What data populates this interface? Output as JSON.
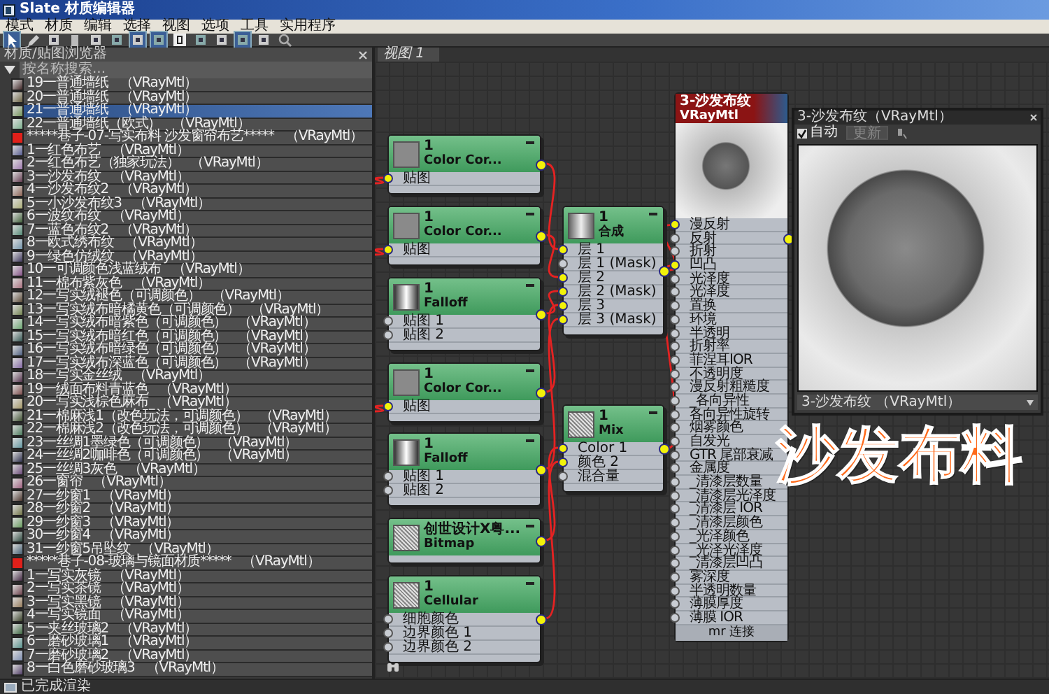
{
  "window": {
    "title": "Slate 材质编辑器"
  },
  "menu": [
    "模式",
    "材质",
    "编辑",
    "选择",
    "视图",
    "选项",
    "工具",
    "实用程序"
  ],
  "browser": {
    "title": "材质/贴图浏览器",
    "search": {
      "placeholder": "按名称搜索..."
    },
    "items": [
      {
        "kind": "material",
        "label": "19一普通墙纸",
        "type": "（VRayMtl）",
        "selected": false
      },
      {
        "kind": "material",
        "label": "20一普通墙纸",
        "type": "（VRayMtl）",
        "selected": false
      },
      {
        "kind": "material",
        "label": "21一普通墙纸",
        "type": "（VRayMtl）",
        "selected": true
      },
      {
        "kind": "material",
        "label": "22一普通墙纸（欧式）",
        "type": "（VRayMtl）",
        "selected": false
      },
      {
        "kind": "header",
        "label": "*****巷子-07-写实布料 沙发窗帘布艺*****",
        "type": "（VRayMtl）",
        "selected": false
      },
      {
        "kind": "material",
        "label": "1一红色布艺",
        "type": "（VRayMtl）",
        "selected": false
      },
      {
        "kind": "material",
        "label": "2一红色布艺（独家玩法）",
        "type": "（VRayMtl）",
        "selected": false
      },
      {
        "kind": "material",
        "label": "3一沙发布纹",
        "type": "（VRayMtl）",
        "selected": false
      },
      {
        "kind": "material",
        "label": "4一沙发布纹2",
        "type": "（VRayMtl）",
        "selected": false
      },
      {
        "kind": "material",
        "label": "5一小沙发布纹3",
        "type": "（VRayMtl）",
        "selected": false
      },
      {
        "kind": "material",
        "label": "6一波纹布纹",
        "type": "（VRayMtl）",
        "selected": false
      },
      {
        "kind": "material",
        "label": "7一蓝色布纹2",
        "type": "（VRayMtl）",
        "selected": false
      },
      {
        "kind": "material",
        "label": "8一欧式绣布纹",
        "type": "（VRayMtl）",
        "selected": false
      },
      {
        "kind": "material",
        "label": "9一绿色仿绒纹",
        "type": "（VRayMtl）",
        "selected": false
      },
      {
        "kind": "material",
        "label": "10一可调颜色浅蓝绒布",
        "type": "（VRayMtl）",
        "selected": false
      },
      {
        "kind": "material",
        "label": "11一棉布紫灰色",
        "type": "（VRayMtl）",
        "selected": false
      },
      {
        "kind": "material",
        "label": "12一写实绒褪色（可调颜色）",
        "type": "（VRayMtl）",
        "selected": false
      },
      {
        "kind": "material",
        "label": "13一写实绒布暗橘黄色（可调颜色）",
        "type": "（VRayMtl）",
        "selected": false
      },
      {
        "kind": "material",
        "label": "14一写实绒布暗紫色（可调颜色）",
        "type": "（VRayMtl）",
        "selected": false
      },
      {
        "kind": "material",
        "label": "15一写实绒布暗红色（可调颜色）",
        "type": "（VRayMtl）",
        "selected": false
      },
      {
        "kind": "material",
        "label": "16一写实绒布暗绿色（可调颜色）",
        "type": "（VRayMtl）",
        "selected": false
      },
      {
        "kind": "material",
        "label": "17一写实绒布深蓝色（可调颜色）",
        "type": "（VRayMtl）",
        "selected": false
      },
      {
        "kind": "material",
        "label": "18一写实金丝绒",
        "type": "（VRayMtl）",
        "selected": false
      },
      {
        "kind": "material",
        "label": "19一绒面布料青蓝色",
        "type": "（VRayMtl）",
        "selected": false
      },
      {
        "kind": "material",
        "label": "20一写实浅棕色麻布",
        "type": "（VRayMtl）",
        "selected": false
      },
      {
        "kind": "material",
        "label": "21一棉麻浅1（改色玩法，可调颜色）",
        "type": "（VRayMtl）",
        "selected": false
      },
      {
        "kind": "material",
        "label": "22一棉麻浅2（改色玩法，可调颜色）",
        "type": "（VRayMtl）",
        "selected": false
      },
      {
        "kind": "material",
        "label": "23一丝绸1墨绿色（可调颜色）",
        "type": "（VRayMtl）",
        "selected": false
      },
      {
        "kind": "material",
        "label": "24一丝绸2咖啡色（可调颜色）",
        "type": "（VRayMtl）",
        "selected": false
      },
      {
        "kind": "material",
        "label": "25一丝绸3灰色",
        "type": "（VRayMtl）",
        "selected": false
      },
      {
        "kind": "material",
        "label": "26一窗帘",
        "type": "（VRayMtl）",
        "selected": false
      },
      {
        "kind": "material",
        "label": "27一纱窗1",
        "type": "（VRayMtl）",
        "selected": false
      },
      {
        "kind": "material",
        "label": "28一纱窗2",
        "type": "（VRayMtl）",
        "selected": false
      },
      {
        "kind": "material",
        "label": "29一纱窗3",
        "type": "（VRayMtl）",
        "selected": false
      },
      {
        "kind": "material",
        "label": "30一纱窗4",
        "type": "（VRayMtl）",
        "selected": false
      },
      {
        "kind": "material",
        "label": "31一纱窗5吊坠纹",
        "type": "（VRayMtl）",
        "selected": false
      },
      {
        "kind": "header",
        "label": "*****巷子-08-玻璃与镜面材质*****",
        "type": "（VRayMtl）",
        "selected": false
      },
      {
        "kind": "material",
        "label": "1一写实灰镜",
        "type": "（VRayMtl）",
        "selected": false
      },
      {
        "kind": "material",
        "label": "2一写实茶镜",
        "type": "（VRayMtl）",
        "selected": false
      },
      {
        "kind": "material",
        "label": "3一写实黑镜",
        "type": "（VRayMtl）",
        "selected": false
      },
      {
        "kind": "material",
        "label": "4一写实镜面",
        "type": "（VRayMtl）",
        "selected": false
      },
      {
        "kind": "material",
        "label": "5一夹丝玻璃2",
        "type": "（VRayMtl）",
        "selected": false
      },
      {
        "kind": "material",
        "label": "6一磨砂玻璃1",
        "type": "（VRayMtl）",
        "selected": false
      },
      {
        "kind": "material",
        "label": "7一磨砂玻璃2",
        "type": "（VRayMtl）",
        "selected": false
      },
      {
        "kind": "material",
        "label": "8一白色磨砂玻璃3",
        "type": "（VRayMtl）",
        "selected": false
      }
    ]
  },
  "view": {
    "tab": "视图 1",
    "nodes": [
      {
        "kind": "color_correction",
        "lines": [
          "1",
          "Color Cor..."
        ],
        "slots": [
          {
            "label": "贴图",
            "connected": true
          }
        ]
      },
      {
        "kind": "color_correction",
        "lines": [
          "1",
          "Color Cor..."
        ],
        "slots": [
          {
            "label": "贴图",
            "connected": true
          }
        ]
      },
      {
        "kind": "falloff",
        "lines": [
          "1",
          "Falloff"
        ],
        "slots": [
          {
            "label": "贴图 1",
            "connected": false
          },
          {
            "label": "贴图 2",
            "connected": false
          }
        ]
      },
      {
        "kind": "color_correction",
        "lines": [
          "1",
          "Color Cor..."
        ],
        "slots": [
          {
            "label": "贴图",
            "connected": true
          }
        ]
      },
      {
        "kind": "falloff",
        "lines": [
          "1",
          "Falloff"
        ],
        "slots": [
          {
            "label": "贴图 1",
            "connected": false
          },
          {
            "label": "贴图 2",
            "connected": false
          }
        ]
      },
      {
        "kind": "bitmap",
        "lines": [
          "创世设计X粤...",
          "Bitmap"
        ]
      },
      {
        "kind": "cellular",
        "lines": [
          "1",
          "Cellular"
        ],
        "slots": [
          {
            "label": "细胞颜色",
            "connected": false
          },
          {
            "label": "边界颜色 1",
            "connected": false
          },
          {
            "label": "边界颜色 2",
            "connected": false
          }
        ]
      },
      {
        "kind": "composite",
        "lines": [
          "1",
          "合成"
        ],
        "slots": [
          {
            "label": "层 1",
            "connected": true
          },
          {
            "label": "层 1 (Mask)",
            "connected": false
          },
          {
            "label": "层 2",
            "connected": true
          },
          {
            "label": "层 2 (Mask)",
            "connected": true
          },
          {
            "label": "层 3",
            "connected": true
          },
          {
            "label": "层 3 (Mask)",
            "connected": true
          }
        ]
      },
      {
        "kind": "mix",
        "lines": [
          "1",
          "Mix"
        ],
        "slots": [
          {
            "label": "Color 1",
            "connected": true
          },
          {
            "label": "颜色 2",
            "connected": true
          },
          {
            "label": "混合量",
            "connected": false
          }
        ]
      }
    ],
    "material": {
      "title": "3-沙发布纹",
      "subtitle": "VRayMtl",
      "footer": "mr 连接",
      "slots": [
        {
          "label": "漫反射",
          "connected": true
        },
        {
          "label": "反射",
          "connected": false
        },
        {
          "label": "折射",
          "connected": false
        },
        {
          "label": "凹凸",
          "connected": true
        },
        {
          "label": "光泽度",
          "connected": false
        },
        {
          "label": "光泽度",
          "connected": false
        },
        {
          "label": "置换",
          "connected": false
        },
        {
          "label": "环境",
          "connected": false
        },
        {
          "label": "半透明",
          "connected": false
        },
        {
          "label": "折射率",
          "connected": false
        },
        {
          "label": "菲涅耳IOR",
          "connected": false
        },
        {
          "label": "不透明度",
          "connected": false
        },
        {
          "label": "漫反射粗糙度",
          "connected": false
        },
        {
          "label": "_各向异性",
          "connected": false
        },
        {
          "label": "各向异性旋转",
          "connected": false
        },
        {
          "label": "烟雾颜色",
          "connected": false
        },
        {
          "label": "自发光",
          "connected": false
        },
        {
          "label": "GTR 尾部衰减",
          "connected": false
        },
        {
          "label": "金属度",
          "connected": false
        },
        {
          "label": "_清漆层数量",
          "connected": false
        },
        {
          "label": "_清漆层光泽度",
          "connected": false
        },
        {
          "label": "_清漆层 IOR",
          "connected": false
        },
        {
          "label": "_清漆层颜色",
          "connected": false
        },
        {
          "label": "_光泽颜色",
          "connected": false
        },
        {
          "label": "_光泽光泽度",
          "connected": false
        },
        {
          "label": "_清漆层凹凸",
          "connected": false
        },
        {
          "label": "雾深度",
          "connected": false
        },
        {
          "label": "半透明数量",
          "connected": false
        },
        {
          "label": "薄膜厚度",
          "connected": false
        },
        {
          "label": "薄膜 IOR",
          "connected": false
        }
      ]
    },
    "preview": {
      "title": "3-沙发布纹（VRayMtl）",
      "auto": {
        "label": "自动",
        "checked": true
      },
      "update": {
        "label": "更新",
        "disabled": true
      },
      "material": "3-沙发布纹 （VRayMtl）"
    },
    "caption": "沙发布料"
  },
  "status_bar": {
    "text": "已完成渲染"
  }
}
